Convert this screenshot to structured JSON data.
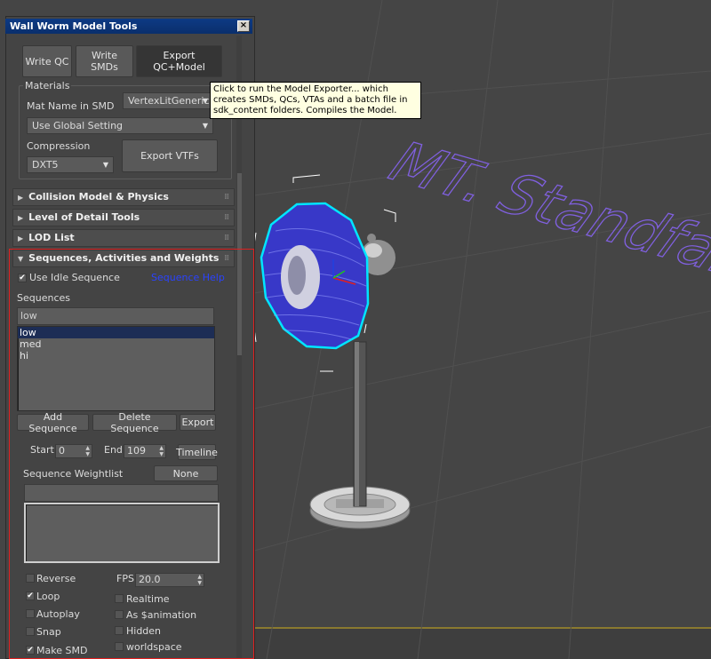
{
  "panel": {
    "title": "Wall Worm Model Tools",
    "close_label": "×"
  },
  "top_buttons": {
    "write_qc": "Write QC",
    "write_smds": "Write SMDs",
    "export_qc_model": "Export QC+Model"
  },
  "tooltip": {
    "text": "Click to run the Model Exporter... which creates SMDs, QCs, VTAs and a batch file in sdk_content folders. Compiles the Model."
  },
  "materials": {
    "group_label": "Materials",
    "mat_name_label": "Mat Name in SMD",
    "shader_value": "VertexLitGeneric",
    "global_setting_value": "Use Global Setting",
    "compression_label": "Compression",
    "compression_value": "DXT5",
    "export_vtfs": "Export VTFs"
  },
  "rollouts": [
    {
      "label": "Collision Model & Physics",
      "expanded": false
    },
    {
      "label": "Level of Detail Tools",
      "expanded": false
    },
    {
      "label": "LOD List",
      "expanded": false
    },
    {
      "label": "Sequences, Activities and Weights",
      "expanded": true
    }
  ],
  "sequences": {
    "use_idle_label": "Use Idle Sequence",
    "use_idle_checked": true,
    "help_link": "Sequence Help",
    "list_label": "Sequences",
    "name_field": "low",
    "items": [
      "low",
      "med",
      "hi"
    ],
    "selected": "low",
    "add_button": "Add Sequence",
    "delete_button": "Delete Sequence",
    "export_button": "Export",
    "start_label": "Start",
    "start_value": "0",
    "end_label": "End",
    "end_value": "109",
    "timeline_button": "Timeline",
    "weightlist_label": "Sequence Weightlist",
    "weightlist_value": "None",
    "fps_label": "FPS",
    "fps_value": "20.0",
    "options": {
      "reverse": {
        "label": "Reverse",
        "checked": false
      },
      "loop": {
        "label": "Loop",
        "checked": true
      },
      "autoplay": {
        "label": "Autoplay",
        "checked": false
      },
      "snap": {
        "label": "Snap",
        "checked": false
      },
      "make_smd": {
        "label": "Make SMD",
        "checked": true
      },
      "realtime": {
        "label": "Realtime",
        "checked": false
      },
      "as_animation": {
        "label": "As $animation",
        "checked": false
      },
      "hidden": {
        "label": "Hidden",
        "checked": false
      },
      "worldspace": {
        "label": "worldspace",
        "checked": false
      }
    }
  },
  "viewport": {
    "background_text": "MT. Standfan..."
  },
  "icons": {
    "rollout_collapsed": "triangle-right-icon",
    "rollout_expanded": "triangle-down-icon",
    "dropdown": "chevron-down-icon",
    "grip": "grip-icon",
    "checkmark": "check-icon"
  },
  "colors": {
    "selection_highlight": "#00e5ff",
    "fan_blade": "#3a3ad0",
    "viewport_text": "#8060e0",
    "panel_title": "#0d3a84",
    "focus_outline": "#e02020"
  }
}
